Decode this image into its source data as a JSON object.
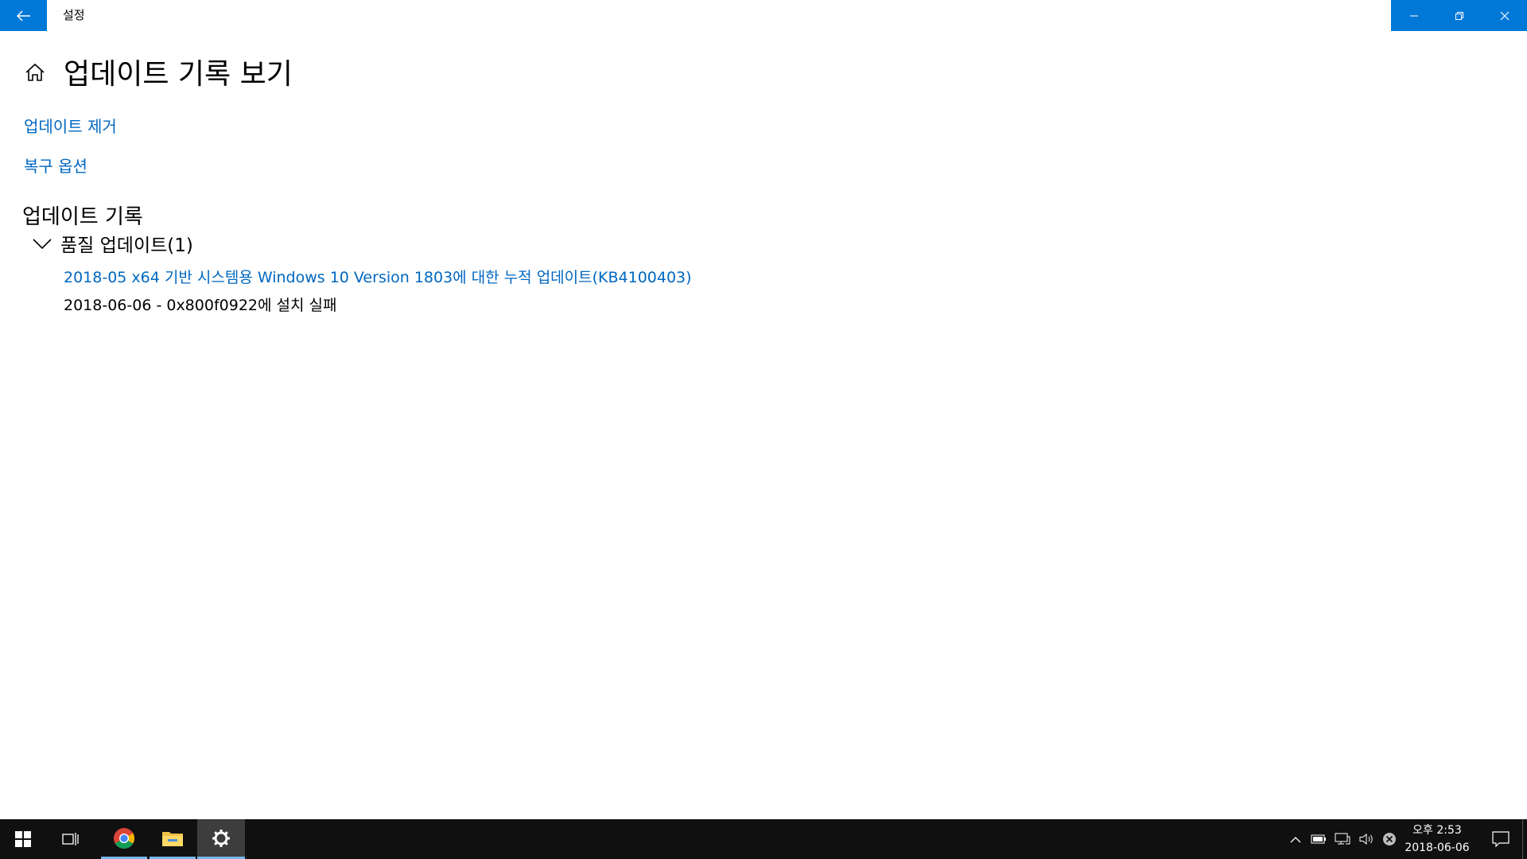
{
  "window": {
    "title": "설정",
    "back_icon": "back-arrow-icon",
    "controls": [
      "minimize-icon",
      "maximize-icon",
      "close-icon"
    ]
  },
  "page": {
    "title": "업데이트 기록 보기",
    "home_icon": "home-icon"
  },
  "links": {
    "remove_updates": "업데이트 제거",
    "recovery_options": "복구 옵션"
  },
  "history": {
    "section_title": "업데이트 기록",
    "group": {
      "label": "품질 업데이트(1)",
      "expanded": true,
      "items": [
        {
          "name": "2018-05 x64 기반 시스템용 Windows 10 Version 1803에 대한 누적 업데이트(KB4100403)",
          "status": "2018-06-06 - 0x800f0922에 설치 실패"
        }
      ]
    }
  },
  "taskbar": {
    "apps": [
      "windows-start-icon",
      "task-view-icon",
      "chrome-icon",
      "file-explorer-icon",
      "settings-gear-icon"
    ],
    "tray_icons": [
      "chevron-up-icon",
      "battery-icon",
      "network-icon",
      "volume-icon",
      "error-icon"
    ],
    "clock": {
      "time": "오후 2:53",
      "date": "2018-06-06"
    },
    "action_center_icon": "notification-icon"
  },
  "colors": {
    "accent": "#0078d7",
    "link": "#0067c0",
    "taskbar": "#101010"
  }
}
